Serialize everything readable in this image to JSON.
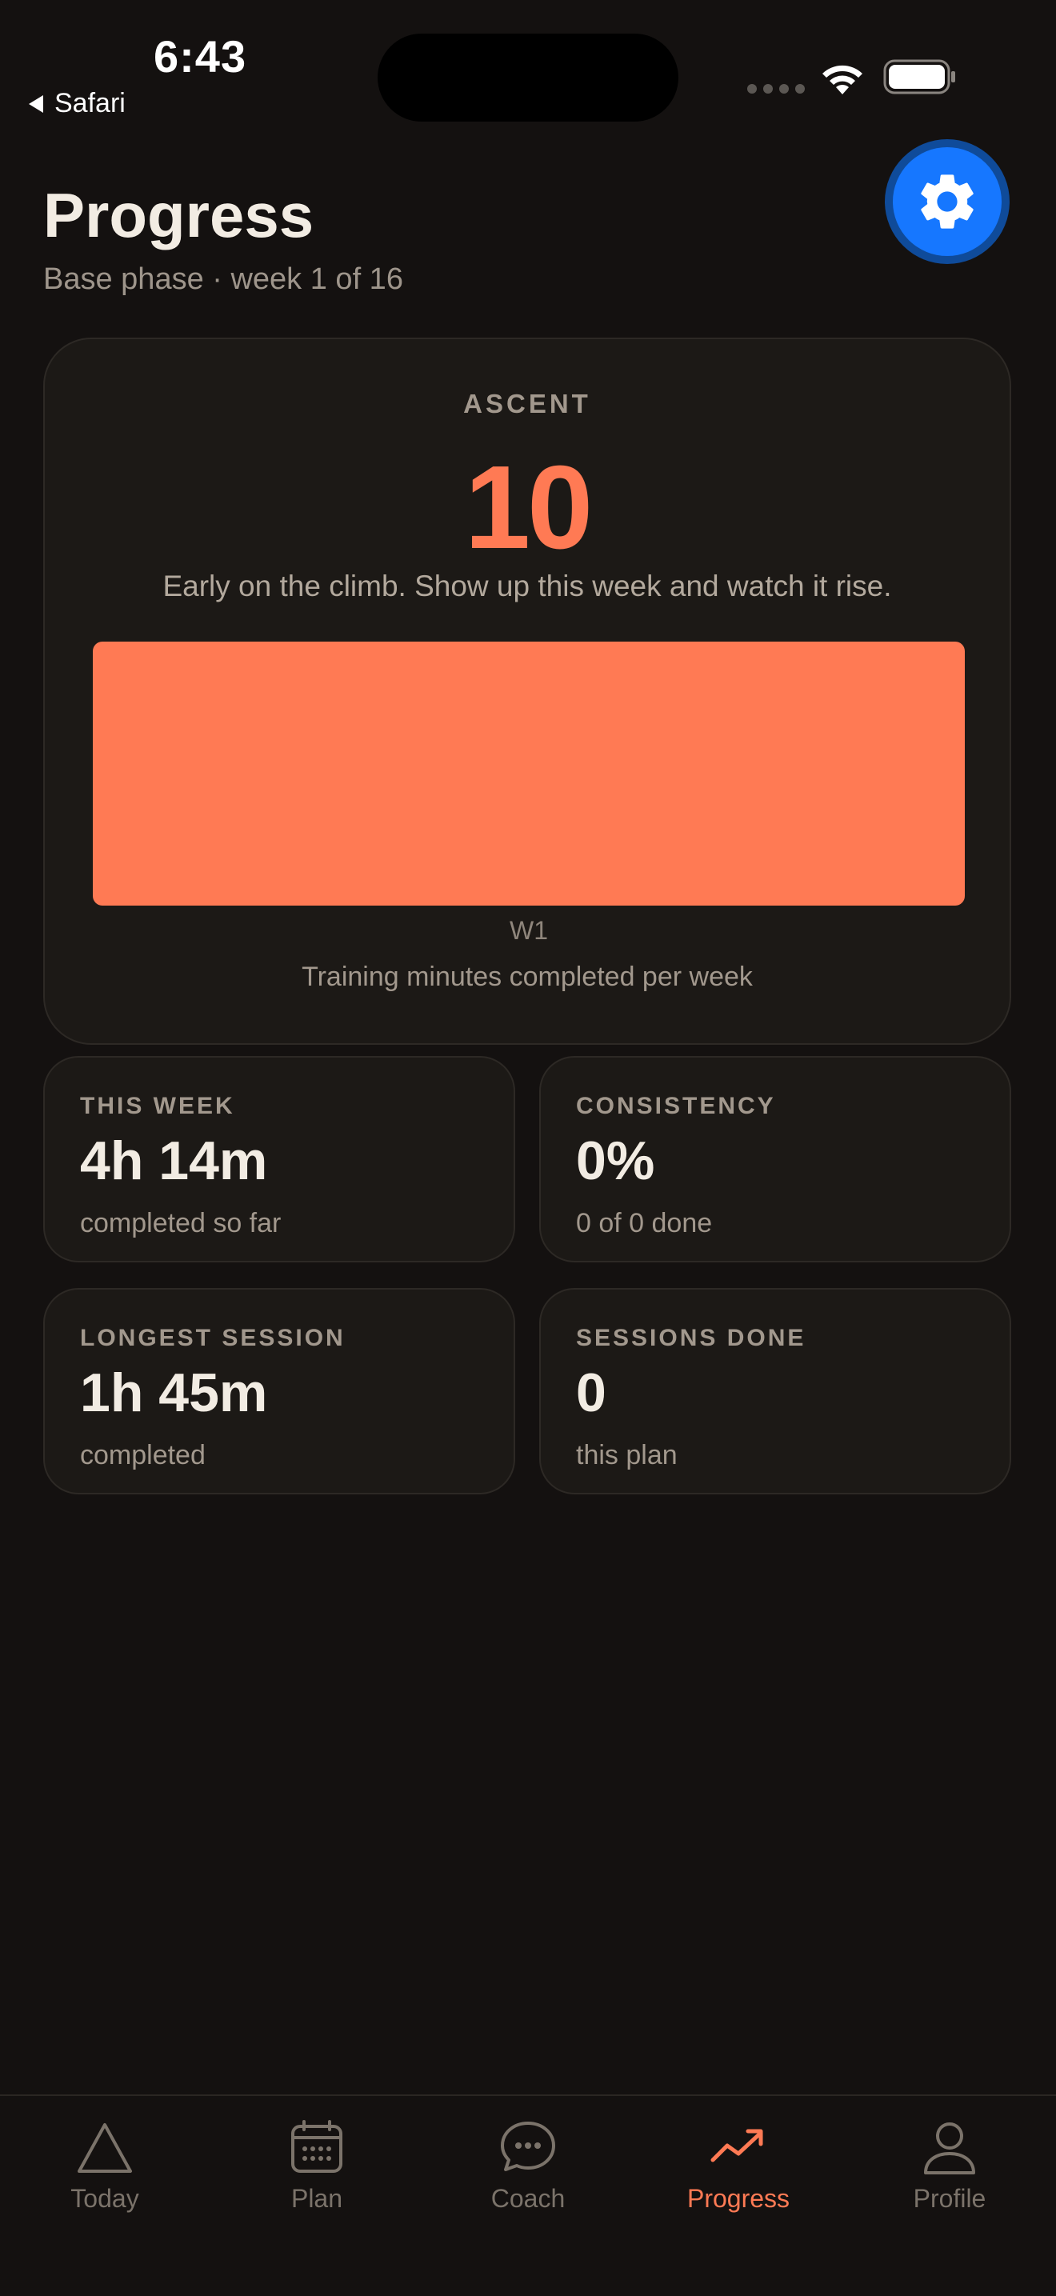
{
  "status_bar": {
    "time": "6:43",
    "back_label": "Safari",
    "icons": [
      "cellular-icon",
      "wifi-icon",
      "battery-icon"
    ]
  },
  "header": {
    "title": "Progress",
    "subtitle": "Base phase · week 1 of 16",
    "settings_icon": "gear-icon"
  },
  "ascent": {
    "label": "ASCENT",
    "value": "10",
    "note": "Early on the climb. Show up this week and watch it rise."
  },
  "chart_data": {
    "type": "bar",
    "title": "",
    "categories": [
      "W1"
    ],
    "values": [
      254
    ],
    "caption": "Training minutes completed per week",
    "color": "#ff7a54",
    "grid": false
  },
  "stats": [
    {
      "label": "THIS WEEK",
      "value": "4h 14m",
      "sub": "completed so far"
    },
    {
      "label": "CONSISTENCY",
      "value": "0%",
      "sub": "0 of 0 done"
    },
    {
      "label": "LONGEST SESSION",
      "value": "1h 45m",
      "sub": "completed"
    },
    {
      "label": "SESSIONS DONE",
      "value": "0",
      "sub": "this plan"
    }
  ],
  "tabs": [
    {
      "label": "Today",
      "icon": "triangle-icon"
    },
    {
      "label": "Plan",
      "icon": "calendar-icon"
    },
    {
      "label": "Coach",
      "icon": "chat-bubble-icon"
    },
    {
      "label": "Progress",
      "icon": "trend-up-icon",
      "active": true
    },
    {
      "label": "Profile",
      "icon": "person-icon"
    }
  ],
  "colors": {
    "background": "#141110",
    "card": "#1c1916",
    "accent": "#ff7a54",
    "settings_button": "#1677ff"
  }
}
